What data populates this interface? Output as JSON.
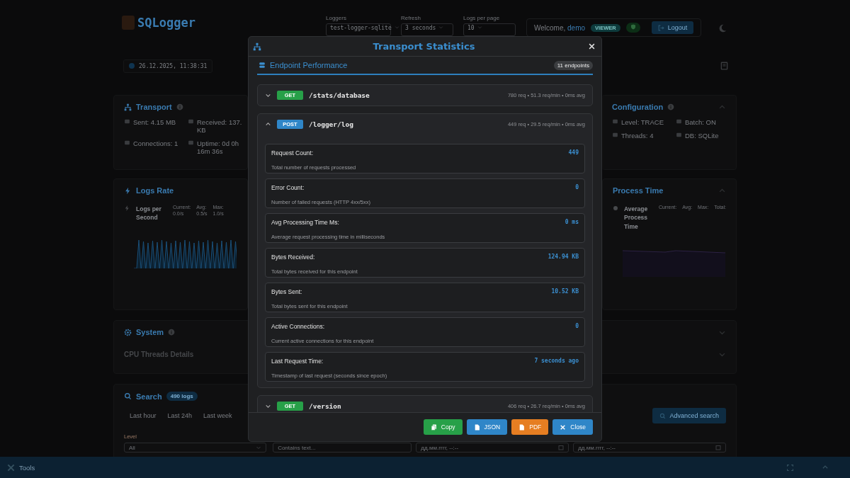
{
  "app": {
    "logo": "SQLogger",
    "selects": [
      {
        "label": "Loggers",
        "value": "test-logger-sqlite"
      },
      {
        "label": "Refresh",
        "value": "3 seconds"
      },
      {
        "label": "Logs per page",
        "value": "10"
      }
    ],
    "welcome": "Welcome,",
    "user": "demo",
    "role": "VIEWER",
    "logout": "Logout",
    "clock": "26.12.2025, 11:38:31",
    "transport": {
      "title": "Transport",
      "items": [
        "Sent: 4.15 MB",
        "Received: 137. KB",
        "Connections: 1",
        "Uptime: 0d 0h 16m 36s"
      ]
    },
    "configuration": {
      "title": "Configuration",
      "items": [
        "Level: TRACE",
        "Batch: ON",
        "Threads: 4",
        "DB: SQLite"
      ]
    },
    "logs_rate": {
      "title": "Logs Rate",
      "heading": "Logs per Second",
      "stats": [
        {
          "label": "Current:",
          "value": "0.0/s"
        },
        {
          "label": "Avg:",
          "value": "0.5/s"
        },
        {
          "label": "Max:",
          "value": "1.0/s"
        }
      ]
    },
    "process_time": {
      "title": "Process Time",
      "heading": "Average Process Time",
      "stats": [
        {
          "label": "Current:"
        },
        {
          "label": "Avg:"
        },
        {
          "label": "Max:"
        },
        {
          "label": "Total:"
        }
      ]
    },
    "system": {
      "title": "System",
      "sub": "CPU Threads Details"
    },
    "search": {
      "title": "Search",
      "count": "490 logs",
      "ranges": [
        "Last hour",
        "Last 24h",
        "Last week"
      ],
      "advanced": "Advanced search",
      "level_label": "Level",
      "level_value": "All",
      "text_placeholder": "Contains text...",
      "date_placeholders": [
        "дд.мм.гггг, --:--",
        "дд.мм.гггг, --:--"
      ]
    },
    "tools": "Tools"
  },
  "modal": {
    "title": "Transport Statistics",
    "section": "Endpoint Performance",
    "count": "11 endpoints",
    "endpoints": [
      {
        "method": "GET",
        "path": "/stats/database",
        "summary": "780 req • 51.3 req/min • 0ms avg",
        "expanded": false
      },
      {
        "method": "POST",
        "path": "/logger/log",
        "summary": "449 req • 29.5 req/min • 0ms avg",
        "expanded": true,
        "metrics": [
          {
            "label": "Request Count:",
            "description": "Total number of requests processed",
            "value": "449"
          },
          {
            "label": "Error Count:",
            "description": "Number of failed requests (HTTP 4xx/5xx)",
            "value": "0"
          },
          {
            "label": "Avg Processing Time Ms:",
            "description": "Average request processing time in milliseconds",
            "value": "0 ms"
          },
          {
            "label": "Bytes Received:",
            "description": "Total bytes received for this endpoint",
            "value": "124.94 KB"
          },
          {
            "label": "Bytes Sent:",
            "description": "Total bytes sent for this endpoint",
            "value": "10.52 KB"
          },
          {
            "label": "Active Connections:",
            "description": "Current active connections for this endpoint",
            "value": "0"
          },
          {
            "label": "Last Request Time:",
            "description": "Timestamp of last request (seconds since epoch)",
            "value": "7 seconds ago"
          }
        ]
      },
      {
        "method": "GET",
        "path": "/version",
        "summary": "406 req • 26.7 req/min • 0ms avg",
        "expanded": false
      }
    ],
    "buttons": [
      {
        "kind": "copy",
        "label": "Copy"
      },
      {
        "kind": "json",
        "label": "JSON"
      },
      {
        "kind": "pdf",
        "label": "PDF"
      },
      {
        "kind": "close",
        "label": "Close"
      }
    ]
  }
}
